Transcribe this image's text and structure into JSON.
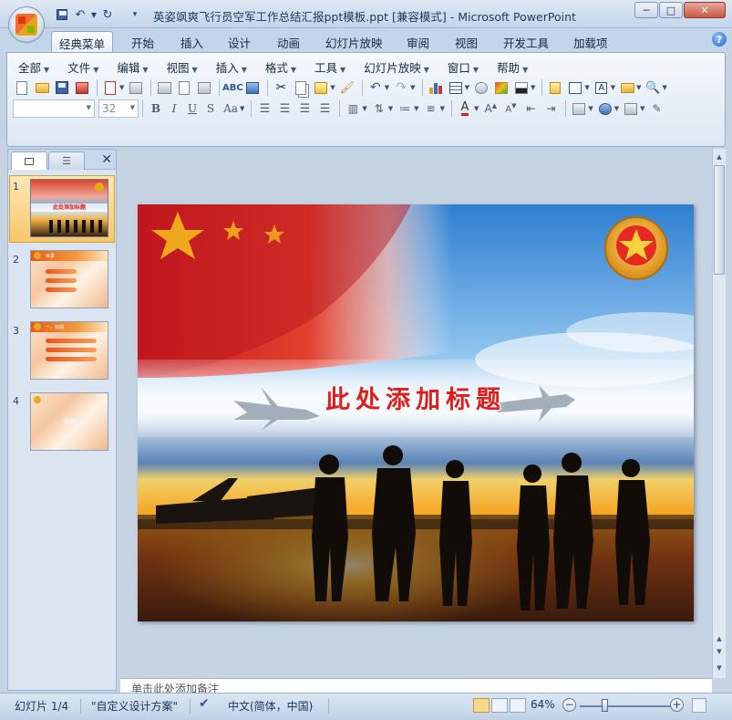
{
  "window": {
    "title": "英姿飒爽飞行员空军工作总结汇报ppt模板.ppt [兼容模式] - Microsoft PowerPoint",
    "minimize": "─",
    "maximize": "□",
    "close": "✕"
  },
  "ribbon_tabs": [
    "经典菜单",
    "开始",
    "插入",
    "设计",
    "动画",
    "幻灯片放映",
    "审阅",
    "视图",
    "开发工具",
    "加载项"
  ],
  "classic_menu": [
    "全部",
    "文件",
    "编辑",
    "视图",
    "插入",
    "格式",
    "工具",
    "幻灯片放映",
    "窗口",
    "帮助"
  ],
  "font_size": "32",
  "format_buttons": [
    "B",
    "I",
    "U",
    "S",
    "Aa"
  ],
  "slide": {
    "title": "此处添加标题"
  },
  "thumbnails": [
    {
      "num": "1",
      "caption": "此处添加标题"
    },
    {
      "num": "2",
      "caption": "目录"
    },
    {
      "num": "3",
      "caption": "一、标题"
    },
    {
      "num": "4",
      "caption": "谢谢"
    }
  ],
  "notes_placeholder": "单击此处添加备注",
  "status": {
    "slide_pos": "幻灯片 1/4",
    "theme": "\"自定义设计方案\"",
    "language": "中文(简体，中国)",
    "zoom": "64%"
  },
  "colors": {
    "accent_orange": "#e55a1d",
    "title_red": "#e31b1b",
    "ribbon_blue": "#c4d5ea"
  }
}
